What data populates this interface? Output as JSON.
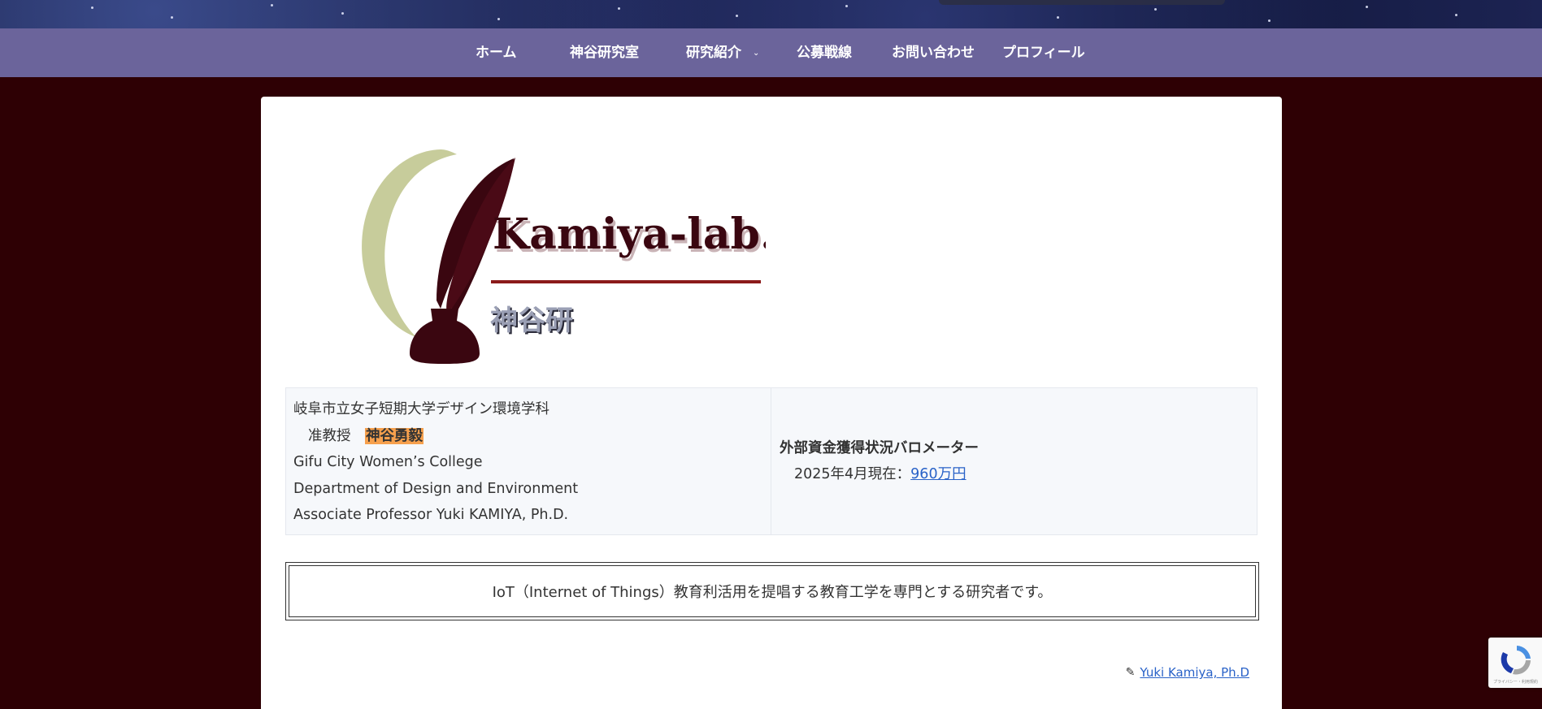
{
  "nav": {
    "items": [
      {
        "label": "ホーム"
      },
      {
        "label": "神谷研究室"
      },
      {
        "label": "研究紹介"
      },
      {
        "label": "公募戦線"
      },
      {
        "label": "お問い合わせ"
      },
      {
        "label": "プロフィール"
      }
    ],
    "background": "#6b649b"
  },
  "logo": {
    "title": "Kamiya-lab.",
    "subtitle": "神谷研"
  },
  "profile": {
    "school_ja": "岐阜市立女子短期大学デザイン環境学科",
    "position_ja": "准教授",
    "name_ja": "神谷勇毅",
    "school_en": "Gifu City Women’s College",
    "department_en": "Department of Design and Environment",
    "position_en": "Associate Professor Yuki KAMIYA, Ph.D."
  },
  "funding": {
    "heading": "外部資金獲得状況バロメーター",
    "date_text": "2025年4月現在：",
    "amount_link": "960万円"
  },
  "lead": {
    "text": "IoT（Internet of Things）教育利活用を提唱する教育工学を専門とする研究者です。"
  },
  "author": {
    "link": "Yuki Kamiya, Ph.D"
  },
  "recaptcha": {
    "tiny_text": "プライバシー・利用規約"
  },
  "colors": {
    "page_bg": "#2e0004",
    "accent_highlight": "#f6a04d",
    "link": "#2962c8"
  }
}
